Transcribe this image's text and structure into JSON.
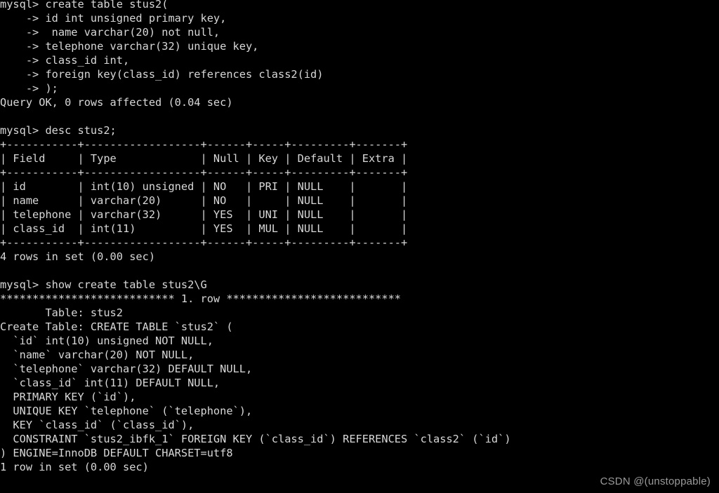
{
  "terminal": {
    "background_color": "#000000",
    "foreground_color": "#d8d8d8",
    "watermark": "CSDN @(unstoppable)",
    "lines": [
      "mysql> create table stus2(",
      "    -> id int unsigned primary key,",
      "    ->  name varchar(20) not null,",
      "    -> telephone varchar(32) unique key,",
      "    -> class_id int,",
      "    -> foreign key(class_id) references class2(id)",
      "    -> );",
      "Query OK, 0 rows affected (0.04 sec)",
      "",
      "mysql> desc stus2;",
      "+-----------+------------------+------+-----+---------+-------+",
      "| Field     | Type             | Null | Key | Default | Extra |",
      "+-----------+------------------+------+-----+---------+-------+",
      "| id        | int(10) unsigned | NO   | PRI | NULL    |       |",
      "| name      | varchar(20)      | NO   |     | NULL    |       |",
      "| telephone | varchar(32)      | YES  | UNI | NULL    |       |",
      "| class_id  | int(11)          | YES  | MUL | NULL    |       |",
      "+-----------+------------------+------+-----+---------+-------+",
      "4 rows in set (0.00 sec)",
      "",
      "mysql> show create table stus2\\G",
      "*************************** 1. row ***************************",
      "       Table: stus2",
      "Create Table: CREATE TABLE `stus2` (",
      "  `id` int(10) unsigned NOT NULL,",
      "  `name` varchar(20) NOT NULL,",
      "  `telephone` varchar(32) DEFAULT NULL,",
      "  `class_id` int(11) DEFAULT NULL,",
      "  PRIMARY KEY (`id`),",
      "  UNIQUE KEY `telephone` (`telephone`),",
      "  KEY `class_id` (`class_id`),",
      "  CONSTRAINT `stus2_ibfk_1` FOREIGN KEY (`class_id`) REFERENCES `class2` (`id`)",
      ") ENGINE=InnoDB DEFAULT CHARSET=utf8",
      "1 row in set (0.00 sec)"
    ]
  }
}
